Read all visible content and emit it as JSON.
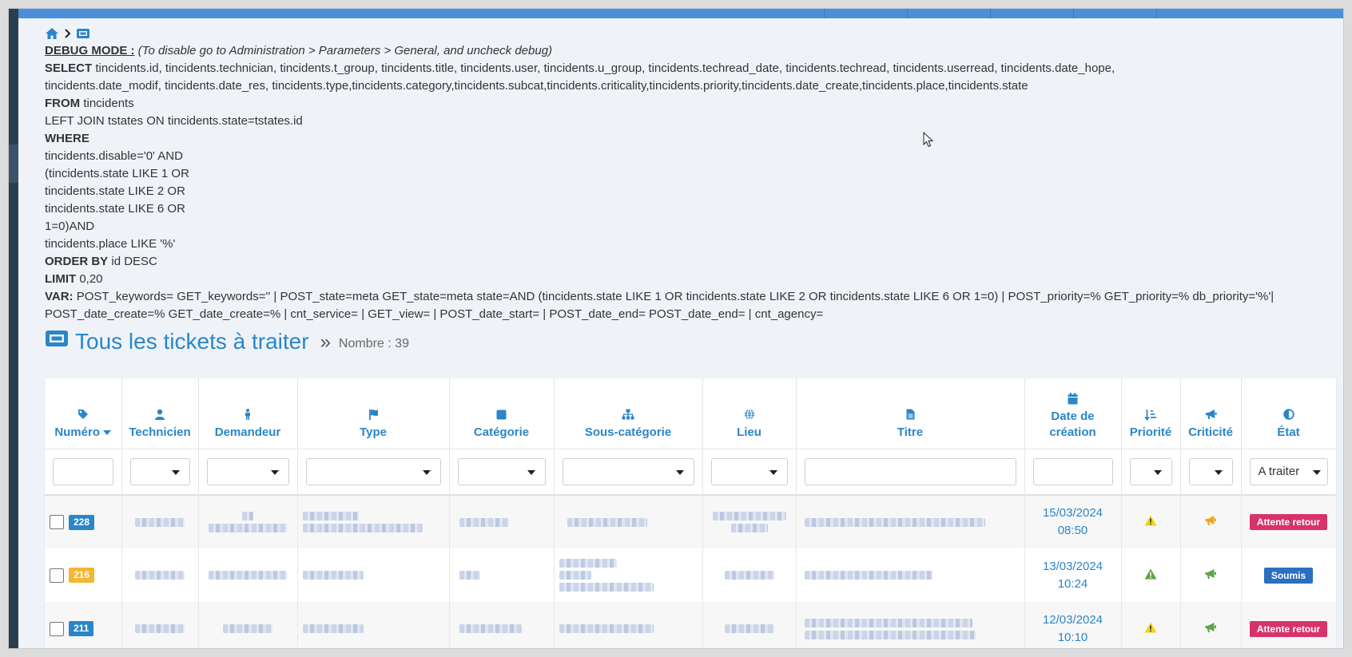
{
  "debug": {
    "head": "DEBUG MODE :",
    "note": "(To disable go to Administration > Parameters > General, and uncheck debug)",
    "select_kw": "SELECT",
    "select_text": "tincidents.id, tincidents.technician, tincidents.t_group, tincidents.title, tincidents.user, tincidents.u_group, tincidents.techread_date, tincidents.techread, tincidents.userread, tincidents.date_hope, tincidents.date_modif, tincidents.date_res, tincidents.type,tincidents.category,tincidents.subcat,tincidents.criticality,tincidents.priority,tincidents.date_create,tincidents.place,tincidents.state",
    "from_kw": "FROM",
    "from_text": "tincidents",
    "join_line": "LEFT JOIN tstates ON tincidents.state=tstates.id",
    "where_kw": "WHERE",
    "where_lines": [
      "tincidents.disable='0' AND",
      "(tincidents.state LIKE 1 OR",
      "tincidents.state LIKE 2 OR",
      "tincidents.state LIKE 6 OR",
      "1=0)AND",
      "tincidents.place LIKE '%'"
    ],
    "order_kw": "ORDER BY",
    "order_text": "id DESC",
    "limit_kw": "LIMIT",
    "limit_text": "0,20",
    "var_kw": "VAR:",
    "var_text": "POST_keywords= GET_keywords='' | POST_state=meta GET_state=meta state=AND (tincidents.state LIKE 1 OR tincidents.state LIKE 2 OR tincidents.state LIKE 6 OR 1=0) | POST_priority=% GET_priority=% db_priority='%'| POST_date_create=% GET_date_create=% | cnt_service= | GET_view= | POST_date_start= | POST_date_end= POST_date_end= | cnt_agency="
  },
  "page": {
    "title": "Tous les tickets à traiter",
    "count_label": "Nombre : 39"
  },
  "table": {
    "columns": [
      {
        "key": "numero",
        "label": "Numéro",
        "icon": "tag-icon"
      },
      {
        "key": "technicien",
        "label": "Technicien",
        "icon": "user-icon"
      },
      {
        "key": "demandeur",
        "label": "Demandeur",
        "icon": "person-icon"
      },
      {
        "key": "type",
        "label": "Type",
        "icon": "flag-icon"
      },
      {
        "key": "categorie",
        "label": "Catégorie",
        "icon": "square-icon"
      },
      {
        "key": "souscategorie",
        "label": "Sous-catégorie",
        "icon": "sitemap-icon"
      },
      {
        "key": "lieu",
        "label": "Lieu",
        "icon": "globe-icon"
      },
      {
        "key": "titre",
        "label": "Titre",
        "icon": "file-icon"
      },
      {
        "key": "date",
        "label_1": "Date de",
        "label_2": "création",
        "icon": "calendar-icon"
      },
      {
        "key": "priorite",
        "label": "Priorité",
        "icon": "sort-icon"
      },
      {
        "key": "criticite",
        "label": "Criticité",
        "icon": "bullhorn-icon"
      },
      {
        "key": "etat",
        "label": "État",
        "icon": "half-circle-icon"
      }
    ],
    "state_filter_value": "A traiter",
    "rows": [
      {
        "number": "228",
        "number_color": "#2a86c9",
        "date": "15/03/2024",
        "time": "08:50",
        "priority_color": "#f0d318",
        "criticality_color": "#f0a818",
        "state": "Attente retour",
        "state_color": "#d8326a"
      },
      {
        "number": "216",
        "number_color": "#f5b632",
        "date": "13/03/2024",
        "time": "10:24",
        "priority_color": "#5ea34a",
        "criticality_color": "#5ea34a",
        "state": "Soumis",
        "state_color": "#2a6fc0"
      },
      {
        "number": "211",
        "number_color": "#2a86c9",
        "date": "12/03/2024",
        "time": "10:10",
        "priority_color": "#f0d318",
        "criticality_color": "#5ea34a",
        "state": "Attente retour",
        "state_color": "#d8326a"
      }
    ]
  }
}
